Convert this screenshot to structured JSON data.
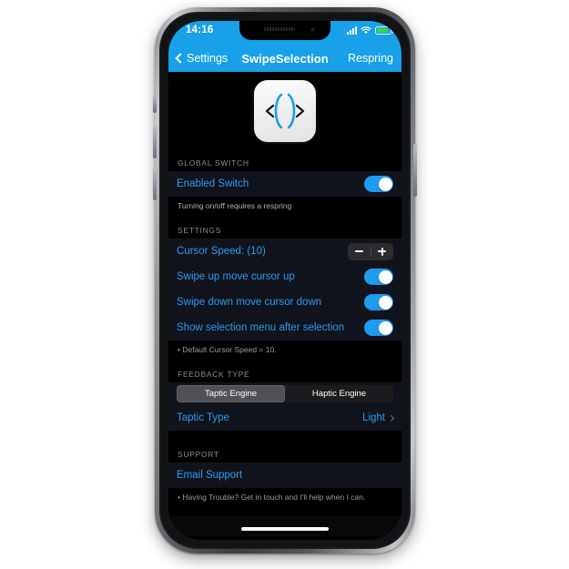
{
  "status_bar": {
    "time": "14:16",
    "cellular_icon": "signal-bars-icon",
    "wifi_icon": "wifi-icon",
    "battery_icon": "battery-icon",
    "battery_color": "#39d44a"
  },
  "nav": {
    "back_label": "Settings",
    "title": "SwipeSelection",
    "right_label": "Respring",
    "tint": "#18a0e8"
  },
  "hero": {
    "icon_name": "swipeselection-app-icon",
    "icon_accent": "#1ba1e2"
  },
  "sections": [
    {
      "header": "GLOBAL SWITCH",
      "rows": [
        {
          "label": "Enabled Switch",
          "control": "toggle",
          "value": "on"
        }
      ],
      "footnote": "Turning on/off requires a respring"
    },
    {
      "header": "SETTINGS",
      "rows": [
        {
          "label": "Cursor Speed: (10)",
          "control": "stepper",
          "minus": "−",
          "plus": "+"
        },
        {
          "label": "Swipe up move cursor up",
          "control": "toggle",
          "value": "on"
        },
        {
          "label": "Swipe down move cursor down",
          "control": "toggle",
          "value": "on"
        },
        {
          "label": "Show selection menu after selection",
          "control": "toggle",
          "value": "on"
        }
      ],
      "footnote": "• Default Cursor Speed = 10."
    },
    {
      "header": "FEEDBACK TYPE",
      "segmented": {
        "options": [
          "Taptic Engine",
          "Haptic Engine"
        ],
        "selected": 0
      },
      "rows": [
        {
          "label": "Taptic Type",
          "control": "disclosure",
          "value": "Light"
        }
      ],
      "footnote": ""
    },
    {
      "header": "SUPPORT",
      "rows": [
        {
          "label": "Email Support",
          "control": "none"
        }
      ],
      "footnote": "• Having Trouble? Get in touch and I'll help when I can."
    }
  ],
  "colors": {
    "row_text": "#2a9cf0",
    "row_bg": "#12141d",
    "screen_bg": "#000000",
    "toggle_on": "#1f9bf0",
    "header_text": "#8c8c92"
  }
}
